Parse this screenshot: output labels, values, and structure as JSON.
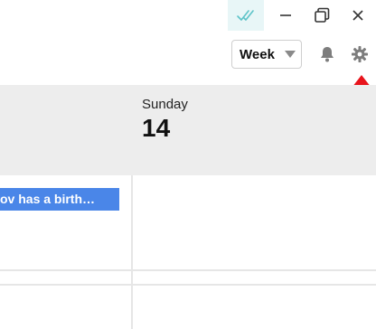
{
  "titlebar": {
    "sync_icon": "double-check-icon",
    "minimize_icon": "minimize-icon",
    "restore_icon": "restore-icon",
    "close_icon": "close-icon"
  },
  "toolbar": {
    "view_select": {
      "selected": "Week"
    },
    "bell_icon": "bell-icon",
    "gear_icon": "gear-icon"
  },
  "calendar": {
    "day": {
      "name": "Sunday",
      "number": "14"
    },
    "events": [
      {
        "title": "ov has a birth…",
        "color": "#4a86e8"
      }
    ]
  },
  "colors": {
    "accent": "#4a86e8",
    "sync_bg": "#e8f6f7",
    "header_bg": "#ededed",
    "annotation": "#e8141c"
  }
}
